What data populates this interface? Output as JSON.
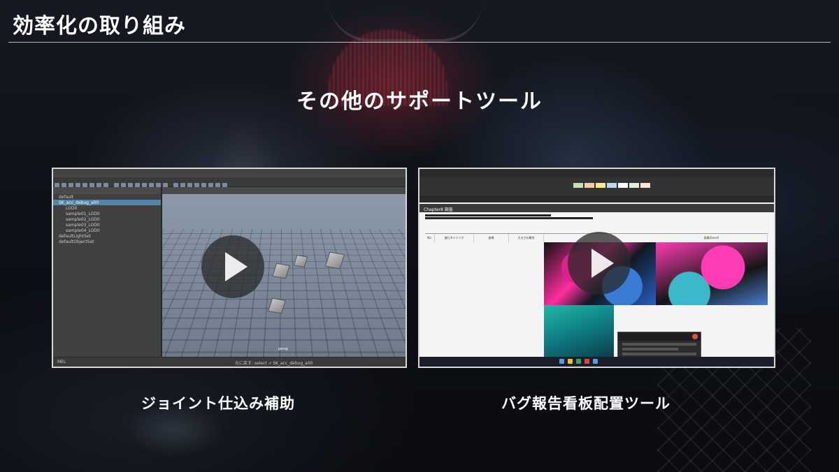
{
  "page": {
    "title": "効率化の取り組み",
    "section_heading": "その他のサポートツール"
  },
  "videos": [
    {
      "caption": "ジョイント仕込み補助",
      "thumbnail": {
        "kind": "3d-software-screenshot",
        "outliner_items": [
          "default",
          "SK_acc_debug_a00",
          "LOD0",
          "sample01_LOD0",
          "sample02_LOD0",
          "sample03_LOD0",
          "sample04_LOD0",
          "defaultLightSet",
          "defaultObjectSet"
        ],
        "viewport_label": "persp",
        "status_left": "MEL",
        "status_command": "元に戻す: select -r SK_acc_debug_a00"
      }
    },
    {
      "caption": "バグ報告看板配置ツール",
      "thumbnail": {
        "kind": "spreadsheet-screenshot",
        "sheet_header": "Chapter8 調査",
        "columns": [
          "No.",
          "進行タイミング",
          "座標",
          "大きさの属性",
          "",
          "画像(Excel)"
        ]
      }
    }
  ],
  "colors": {
    "title_rule": "#ffffff",
    "card_border": "#d8d8d8",
    "outliner_selected": "#5285a6",
    "accent_pink": "#ff2da0",
    "accent_teal": "#1fb9a7"
  },
  "icons": {
    "play": "play-triangle"
  }
}
